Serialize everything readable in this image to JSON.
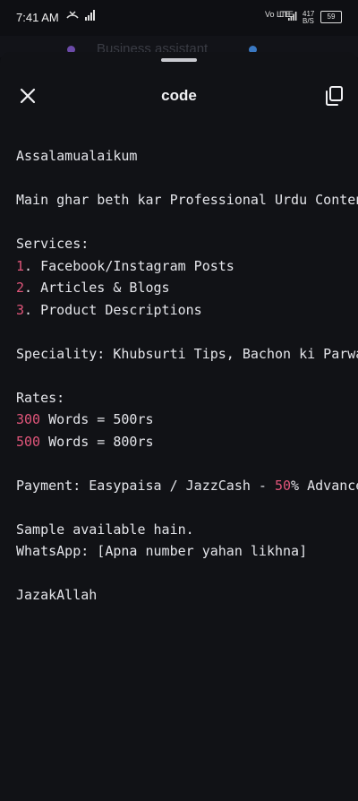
{
  "status_bar": {
    "time": "7:41 AM",
    "network_left": "Vo LTE",
    "network_right": "LTE",
    "speed": "417 B/S",
    "battery": "59"
  },
  "background": {
    "partial_text": "Business assistant"
  },
  "sheet": {
    "title": "code",
    "close_label": "close",
    "copy_label": "copy"
  },
  "code": {
    "greeting": "Assalamualaikum",
    "intro": "Main ghar beth kar Professional Urdu Content",
    "services_header": "Services:",
    "service_1_num": "1",
    "service_1_text": ". Facebook/Instagram Posts",
    "service_2_num": "2",
    "service_2_text": ". Articles & Blogs",
    "service_3_num": "3",
    "service_3_text": ". Product Descriptions",
    "speciality": "Speciality: Khubsurti Tips, Bachon ki Parwarish",
    "rates_header": "Rates:",
    "rate_1_num": "300",
    "rate_1_text": " Words = 500rs",
    "rate_2_num": "500",
    "rate_2_text": " Words = 800rs",
    "payment_prefix": "Payment: Easypaisa / JazzCash - ",
    "payment_num": "50",
    "payment_suffix": "% Advance",
    "sample": "Sample available hain.",
    "whatsapp": "WhatsApp: [Apna number yahan likhna]",
    "closing": "JazakAllah"
  },
  "colors": {
    "background": "#111216",
    "text": "#e4e5ea",
    "number_highlight": "#e0557a"
  }
}
